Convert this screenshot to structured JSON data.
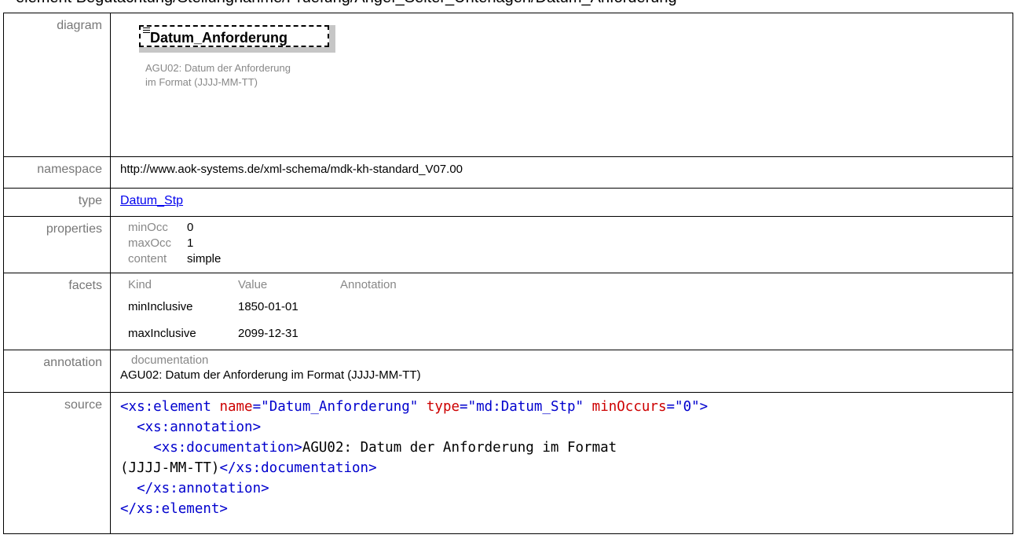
{
  "heading": "element Begutachtung/Stellungnahme/Pruefung/Angef_Seiter_Unterlagen/Datum_Anforderung",
  "labels": {
    "diagram": "diagram",
    "namespace": "namespace",
    "type": "type",
    "properties": "properties",
    "facets": "facets",
    "annotation": "annotation",
    "source": "source"
  },
  "diagram": {
    "element_name": "Datum_Anforderung",
    "note": "AGU02: Datum der Anforderung im Format (JJJJ-MM-TT)"
  },
  "namespace": "http://www.aok-systems.de/xml-schema/mdk-kh-standard_V07.00",
  "type_link": "Datum_Stp",
  "properties": [
    {
      "key": "minOcc",
      "value": "0"
    },
    {
      "key": "maxOcc",
      "value": "1"
    },
    {
      "key": "content",
      "value": "simple"
    }
  ],
  "facets": {
    "headers": [
      "Kind",
      "Value",
      "Annotation"
    ],
    "rows": [
      {
        "kind": "minInclusive",
        "value": "1850-01-01",
        "annotation": ""
      },
      {
        "kind": "maxInclusive",
        "value": "2099-12-31",
        "annotation": ""
      }
    ]
  },
  "annotation": {
    "head": "documentation",
    "text": "AGU02: Datum der Anforderung im Format (JJJJ-MM-TT)"
  },
  "source": {
    "l1_open": "<xs:element",
    "l1_name_attr": "name",
    "l1_name_val": "\"Datum_Anforderung\"",
    "l1_type_attr": "type",
    "l1_type_val": "\"md:Datum_Stp\"",
    "l1_min_attr": "minOccurs",
    "l1_min_val": "\"0\"",
    "l2": "<xs:annotation>",
    "l3_open": "<xs:documentation>",
    "l3_text": "AGU02: Datum der Anforderung im Format",
    "l4_text": "(JJJJ-MM-TT)",
    "l4_close": "</xs:documentation>",
    "l5": "</xs:annotation>",
    "l6": "</xs:element>"
  }
}
